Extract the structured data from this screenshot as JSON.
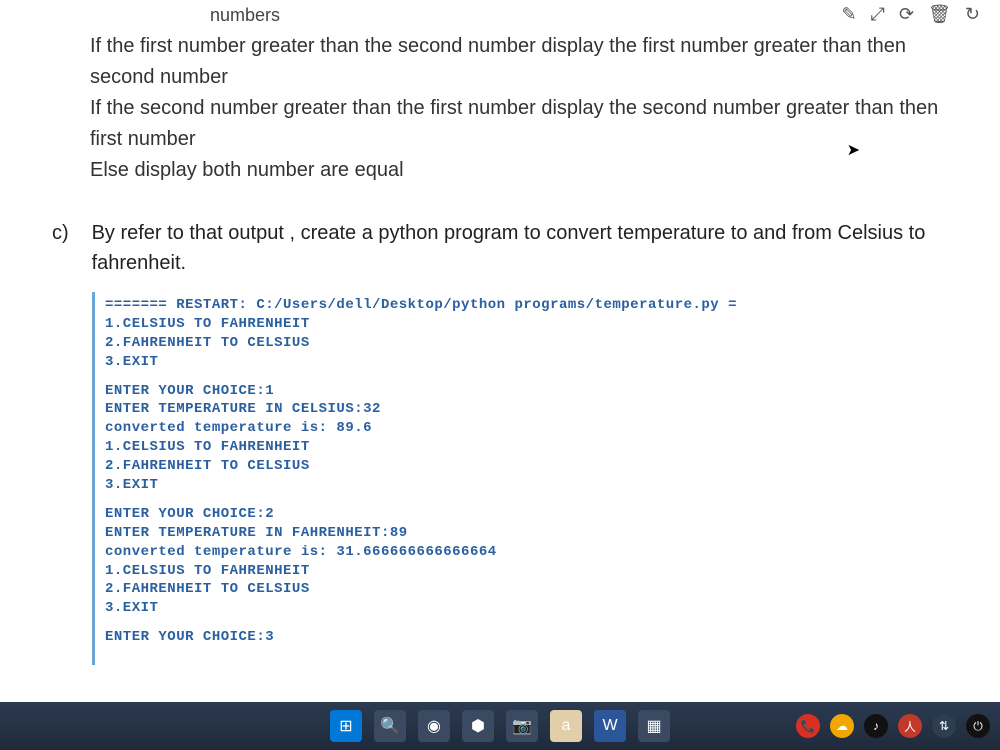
{
  "toolbar": {
    "icons": [
      "✎",
      "⤢",
      "⟳",
      "🗑",
      "↻"
    ]
  },
  "question_partial_top": "numbers",
  "question_lines": [
    "If the first number greater than the second number display the first number greater than then second number",
    "If the second number greater than the first number display the second number greater than then first number",
    "Else display both number are equal"
  ],
  "part_c": {
    "label": "c)",
    "text": "By refer to that output , create a python program to convert temperature to and from Celsius to fahrenheit."
  },
  "terminal": {
    "restart_line": "======= RESTART: C:/Users/dell/Desktop/python programs/temperature.py =",
    "menu": [
      "1.CELSIUS TO FAHRENHEIT",
      "2.FAHRENHEIT TO CELSIUS",
      "3.EXIT"
    ],
    "run1": {
      "choice": "ENTER YOUR CHOICE:1",
      "input": "ENTER TEMPERATURE IN CELSIUS:32",
      "output": "converted temperature is: 89.6"
    },
    "run2": {
      "choice": "ENTER YOUR CHOICE:2",
      "input": "ENTER TEMPERATURE IN FAHRENHEIT:89",
      "output": "converted temperature is: 31.666666666666664"
    },
    "run3": {
      "choice": "ENTER YOUR CHOICE:3"
    }
  },
  "taskbar": {
    "apps": [
      {
        "name": "start",
        "color": "#0078d7",
        "glyph": "⊞"
      },
      {
        "name": "search",
        "color": "#3b4a61",
        "glyph": "🔍"
      },
      {
        "name": "chrome",
        "color": "#3b4a61",
        "glyph": "◉"
      },
      {
        "name": "dropbox",
        "color": "#3b4a61",
        "glyph": "⬢"
      },
      {
        "name": "camera",
        "color": "#3b4a61",
        "glyph": "📷"
      },
      {
        "name": "amazon",
        "color": "#e0cfa8",
        "glyph": "a"
      },
      {
        "name": "word",
        "color": "#2b579a",
        "glyph": "W"
      },
      {
        "name": "app",
        "color": "#3b4a61",
        "glyph": "▦"
      }
    ],
    "sys": [
      {
        "name": "meet",
        "color": "#d93025",
        "glyph": "📞"
      },
      {
        "name": "cloud",
        "color": "#f2a600",
        "glyph": "☁"
      },
      {
        "name": "tiktok",
        "color": "#111",
        "glyph": "♪"
      },
      {
        "name": "person",
        "color": "#c0392b",
        "glyph": "人"
      },
      {
        "name": "network",
        "color": "#2c3e50",
        "glyph": "⇅"
      },
      {
        "name": "power",
        "color": "#111",
        "glyph": "⏻"
      }
    ]
  }
}
